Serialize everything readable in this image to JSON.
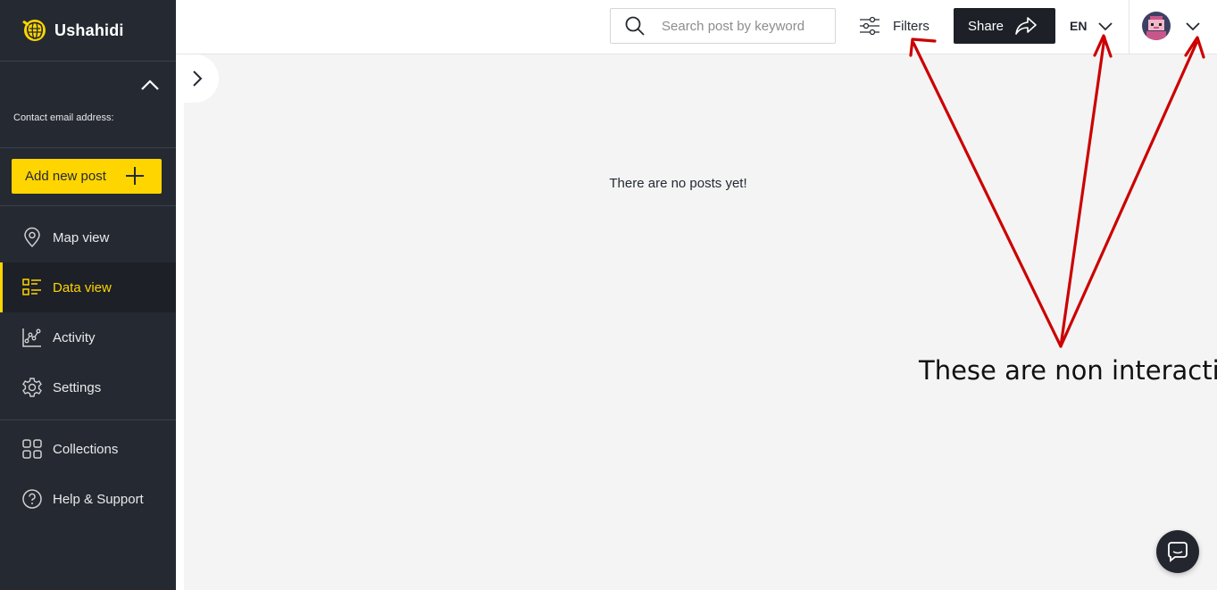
{
  "app": {
    "name": "Ushahidi"
  },
  "sidebar": {
    "contact_label": "Contact email address:",
    "add_post_label": "Add new post",
    "nav_primary": [
      {
        "label": "Map view",
        "icon": "map-pin-icon",
        "active": false
      },
      {
        "label": "Data view",
        "icon": "data-list-icon",
        "active": true
      },
      {
        "label": "Activity",
        "icon": "activity-chart-icon",
        "active": false
      },
      {
        "label": "Settings",
        "icon": "gear-icon",
        "active": false
      }
    ],
    "nav_secondary": [
      {
        "label": "Collections",
        "icon": "collections-grid-icon"
      },
      {
        "label": "Help & Support",
        "icon": "help-circle-icon"
      }
    ]
  },
  "header": {
    "search_placeholder": "Search post by keyword",
    "filters_label": "Filters",
    "share_label": "Share",
    "language": "EN"
  },
  "main": {
    "empty_message": "There are no posts yet!"
  },
  "annotation": {
    "text": "These are non interactive",
    "color": "#cc0000"
  },
  "colors": {
    "sidebar_bg": "#252932",
    "accent": "#ffd500",
    "share_bg": "#1d2027"
  }
}
